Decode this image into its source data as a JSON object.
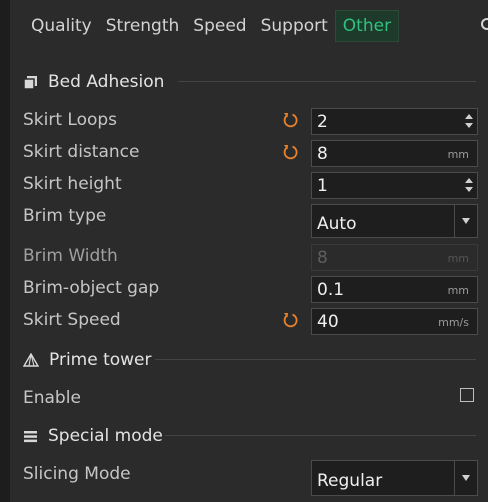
{
  "tabs": [
    {
      "label": "Quality",
      "active": false
    },
    {
      "label": "Strength",
      "active": false
    },
    {
      "label": "Speed",
      "active": false
    },
    {
      "label": "Support",
      "active": false
    },
    {
      "label": "Other",
      "active": true
    }
  ],
  "sections": {
    "bed_adhesion": {
      "title": "Bed Adhesion",
      "icon": "bed-adhesion-icon"
    },
    "prime_tower": {
      "title": "Prime tower",
      "icon": "prime-tower-icon"
    },
    "special_mode": {
      "title": "Special mode",
      "icon": "special-mode-icon"
    }
  },
  "rows": {
    "skirt_loops": {
      "label": "Skirt Loops",
      "value": "2",
      "unit": "",
      "modified": true
    },
    "skirt_distance": {
      "label": "Skirt distance",
      "value": "8",
      "unit": "mm",
      "modified": true
    },
    "skirt_height": {
      "label": "Skirt height",
      "value": "1",
      "unit": "",
      "modified": false
    },
    "brim_type": {
      "label": "Brim type",
      "value": "Auto"
    },
    "brim_width": {
      "label": "Brim Width",
      "value": "8",
      "unit": "mm",
      "disabled": true
    },
    "brim_object_gap": {
      "label": "Brim-object gap",
      "value": "0.1",
      "unit": "mm"
    },
    "skirt_speed": {
      "label": "Skirt Speed",
      "value": "40",
      "unit": "mm/s",
      "modified": true
    },
    "enable": {
      "label": "Enable",
      "checked": false
    },
    "slicing_mode": {
      "label": "Slicing Mode",
      "value": "Regular"
    }
  },
  "colors": {
    "accent_green": "#2ec27e",
    "reset_orange": "#e8822c",
    "background": "#2b2b2b"
  }
}
